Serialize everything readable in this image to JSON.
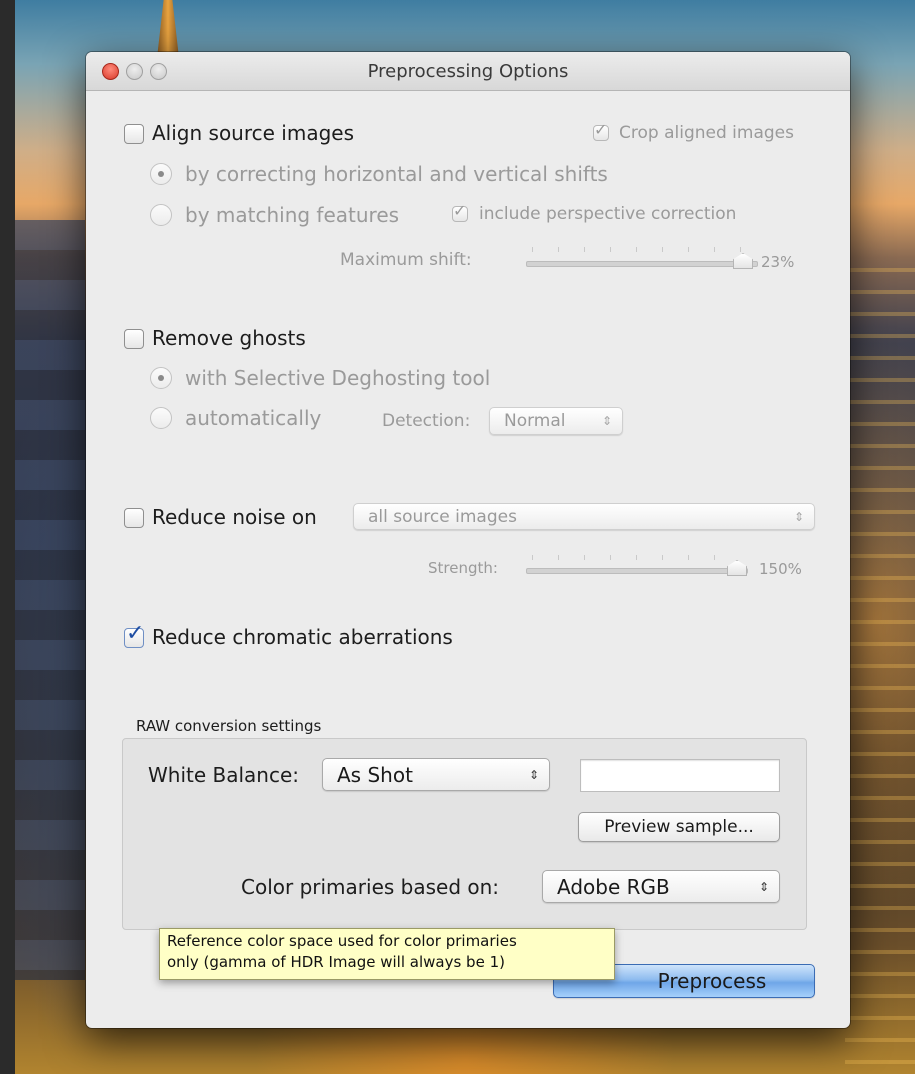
{
  "window": {
    "title": "Preprocessing Options"
  },
  "align": {
    "label": "Align source images",
    "checked": false,
    "crop_label": "Crop aligned images",
    "crop_checked": true,
    "option_shifts": "by correcting horizontal and vertical shifts",
    "option_features": "by matching features",
    "selected_option": "by correcting horizontal and vertical shifts",
    "perspective_label": "include perspective correction",
    "perspective_checked": true,
    "max_shift_label": "Maximum shift:",
    "max_shift_value": "23%"
  },
  "ghosts": {
    "label": "Remove ghosts",
    "checked": false,
    "option_selective": "with Selective Deghosting tool",
    "option_auto": "automatically",
    "selected_option": "with Selective Deghosting tool",
    "detection_label": "Detection:",
    "detection_value": "Normal"
  },
  "noise": {
    "label": "Reduce noise on",
    "checked": false,
    "target_value": "all source images",
    "strength_label": "Strength:",
    "strength_value": "150%"
  },
  "chromatic": {
    "label": "Reduce chromatic aberrations",
    "checked": true
  },
  "raw": {
    "group_label": "RAW conversion settings",
    "white_balance_label": "White Balance:",
    "white_balance_value": "As Shot",
    "white_balance_field": "",
    "preview_button": "Preview sample...",
    "primaries_label": "Color primaries based on:",
    "primaries_value": "Adobe RGB"
  },
  "tooltip": {
    "line1": "Reference color space used for color primaries",
    "line2": "only (gamma of HDR Image will always be 1)"
  },
  "actions": {
    "preprocess_button": "Preprocess"
  },
  "icons": {
    "checkmark": "checkmark-icon",
    "radio_dot": "radio-selected-dot",
    "popup_arrows": "up-down-arrows-icon"
  },
  "colors": {
    "accent_blue": "#6fa6e8",
    "tooltip_bg": "#ffffc6",
    "checkmark": "#1f4ea3"
  }
}
